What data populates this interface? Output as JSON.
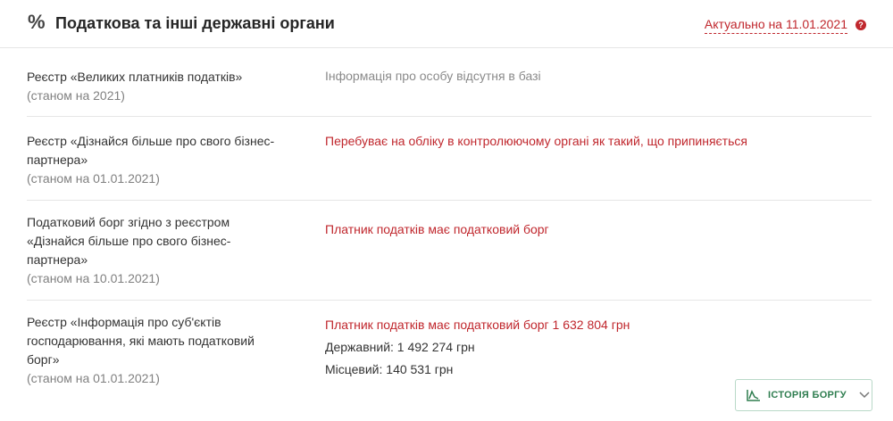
{
  "header": {
    "icon": "percent-icon",
    "title": "Податкова та інші державні органи",
    "actual_text": "Актуально на 11.01.2021",
    "help_icon": "question-icon"
  },
  "rows": [
    {
      "name_lines": [
        "Реєстр «Великих платників податків»"
      ],
      "as_of": "(станом на 2021)",
      "value": "Інформація про особу відсутня в базі"
    },
    {
      "name_lines": [
        "Реєстр «Дізнайся більше про свого бізнес-",
        "партнера»"
      ],
      "as_of": "(станом на 01.01.2021)",
      "value": "Перебуває на обліку в контролюючому органі як такий, що припиняється"
    },
    {
      "name_lines": [
        "Податковий борг згідно з реєстром",
        "«Дізнайся більше про свого бізнес-",
        "партнера»"
      ],
      "as_of": "(станом на 10.01.2021)",
      "value": "Платник податків має податковий борг"
    },
    {
      "name_lines": [
        "Реєстр «Інформація про суб'єктів",
        "господарювання, які мають податковий",
        "борг»"
      ],
      "as_of": "(станом на 01.01.2021)",
      "value": "Платник податків має податковий борг 1 632 804 грн",
      "state": "Державний: 1 492 274 грн",
      "local": "Місцевий: 140 531 грн"
    }
  ],
  "debt_history_button": {
    "label": "ІСТОРІЯ БОРГУ",
    "icon": "chart-icon",
    "chevron": "chevron-down-icon"
  },
  "colors": {
    "accent_red": "#c0272d",
    "button_green": "#2e7d4f"
  }
}
